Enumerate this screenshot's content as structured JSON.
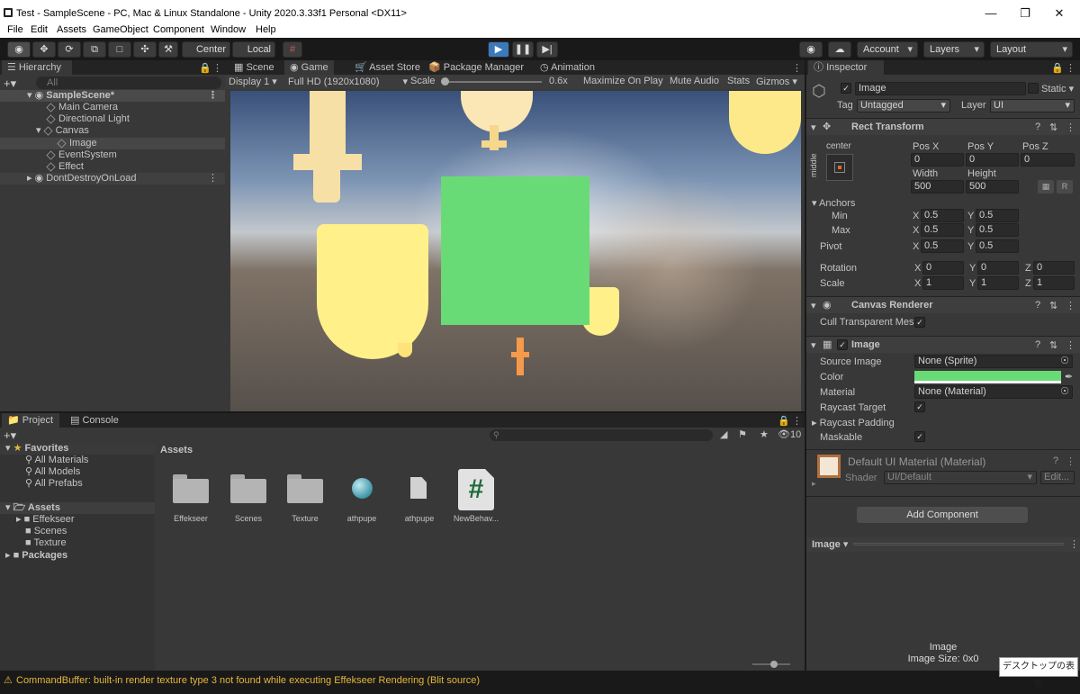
{
  "window": {
    "title": "Test - SampleScene - PC, Mac & Linux Standalone - Unity 2020.3.33f1 Personal <DX11>",
    "minimize_icon": "minimize-icon",
    "maximize_icon": "restore-icon",
    "close_icon": "close-icon"
  },
  "menu": [
    "File",
    "Edit",
    "Assets",
    "GameObject",
    "Component",
    "Window",
    "Help"
  ],
  "toolbar": {
    "pivot": "Center",
    "space": "Local",
    "account": "Account",
    "layers": "Layers",
    "layout": "Layout"
  },
  "hierarchy": {
    "tab": "Hierarchy",
    "search_placeholder": "All",
    "items": [
      "SampleScene*",
      "Main Camera",
      "Directional Light",
      "Canvas",
      "Image",
      "EventSystem",
      "Effect",
      "DontDestroyOnLoad"
    ]
  },
  "game_view": {
    "tabs": [
      "Scene",
      "Game",
      "Asset Store",
      "Package Manager",
      "Animation"
    ],
    "display": "Display 1",
    "resolution": "Full HD (1920x1080)",
    "scale_label": "Scale",
    "scale_value": "0.6x",
    "maximize": "Maximize On Play",
    "mute": "Mute Audio",
    "stats": "Stats",
    "gizmos": "Gizmos",
    "square_color": "#69db76"
  },
  "inspector": {
    "tab": "Inspector",
    "object_name": "Image",
    "static_label": "Static",
    "tag_label": "Tag",
    "tag_value": "Untagged",
    "layer_label": "Layer",
    "layer_value": "UI",
    "rect_transform": {
      "title": "Rect Transform",
      "anchor_h": "center",
      "anchor_v": "middle",
      "pos_x_label": "Pos X",
      "pos_y_label": "Pos Y",
      "pos_z_label": "Pos Z",
      "pos_x": "0",
      "pos_y": "0",
      "pos_z": "0",
      "width_label": "Width",
      "height_label": "Height",
      "width": "500",
      "height": "500",
      "r_label": "R",
      "anchors_label": "Anchors",
      "min_label": "Min",
      "max_label": "Max",
      "pivot_label": "Pivot",
      "x": "X",
      "y": "Y",
      "z": "Z",
      "min_x": "0.5",
      "min_y": "0.5",
      "max_x": "0.5",
      "max_y": "0.5",
      "pivot_x": "0.5",
      "pivot_y": "0.5",
      "rotation_label": "Rotation",
      "rot_x": "0",
      "rot_y": "0",
      "rot_z": "0",
      "scale_label": "Scale",
      "scale_x": "1",
      "scale_y": "1",
      "scale_z": "1"
    },
    "canvas_renderer": {
      "title": "Canvas Renderer",
      "cull_label": "Cull Transparent Mes"
    },
    "image": {
      "title": "Image",
      "source_label": "Source Image",
      "source_value": "None (Sprite)",
      "color_label": "Color",
      "color_value": "#69db76",
      "material_label": "Material",
      "material_value": "None (Material)",
      "raycast_target": "Raycast Target",
      "raycast_padding": "Raycast Padding",
      "maskable": "Maskable"
    },
    "material": {
      "name": "Default UI Material (Material)",
      "shader_label": "Shader",
      "shader_value": "UI/Default",
      "edit": "Edit..."
    },
    "add_component": "Add Component",
    "preview_dropdown": "Image",
    "preview_name": "Image",
    "preview_size": "Image Size: 0x0"
  },
  "project": {
    "tabs": [
      "Project",
      "Console"
    ],
    "favorites_label": "Favorites",
    "favorites": [
      "All Materials",
      "All Models",
      "All Prefabs"
    ],
    "assets_label": "Assets",
    "folders": [
      "Effekseer",
      "Scenes",
      "Texture"
    ],
    "packages_label": "Packages",
    "breadcrumb": "Assets",
    "hidden_count": "10",
    "grid": [
      {
        "name": "Effekseer",
        "icon": "folder-icon"
      },
      {
        "name": "Scenes",
        "icon": "folder-icon"
      },
      {
        "name": "Texture",
        "icon": "folder-icon"
      },
      {
        "name": "athpupe",
        "icon": "material-sphere-icon"
      },
      {
        "name": "athpupe",
        "icon": "file-icon"
      },
      {
        "name": "NewBehav...",
        "icon": "csharp-script-icon"
      }
    ]
  },
  "status_bar": {
    "message": "CommandBuffer: built-in render texture type 3 not found while executing Effekseer Rendering (Blit source)",
    "color": "#e6b73b"
  },
  "tooltip": "デスクトップの表示"
}
